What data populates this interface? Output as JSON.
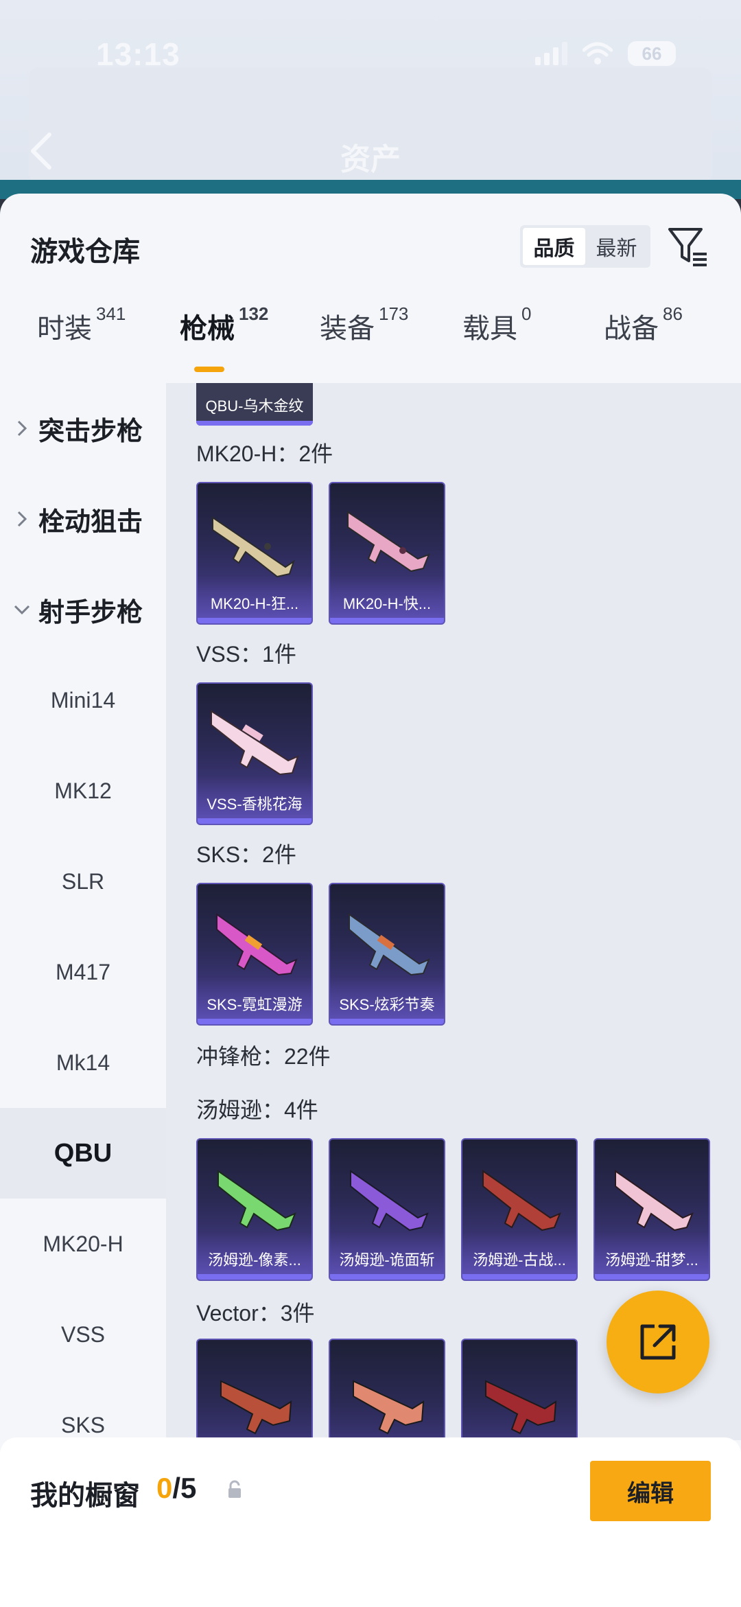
{
  "status_bar": {
    "time": "13:13",
    "battery": "66"
  },
  "header": {
    "title": "资产"
  },
  "warehouse": {
    "title": "游戏仓库",
    "sort_options": [
      "品质",
      "最新"
    ],
    "active_sort": "品质"
  },
  "tabs": [
    {
      "label": "时装",
      "count": "341"
    },
    {
      "label": "枪械",
      "count": "132"
    },
    {
      "label": "装备",
      "count": "173"
    },
    {
      "label": "载具",
      "count": "0"
    },
    {
      "label": "战备",
      "count": "86"
    }
  ],
  "active_tab": "枪械",
  "sidebar": {
    "groups": [
      {
        "label": "突击步枪",
        "expanded": false
      },
      {
        "label": "栓动狙击",
        "expanded": false
      },
      {
        "label": "射手步枪",
        "expanded": true
      }
    ],
    "items": [
      "Mini14",
      "MK12",
      "SLR",
      "M417",
      "Mk14",
      "QBU",
      "MK20-H",
      "VSS",
      "SKS"
    ],
    "active_item": "QBU"
  },
  "content": {
    "partial_item": "QBU-乌木金纹",
    "sections": [
      {
        "label": "MK20-H：2件",
        "items": [
          "MK20-H-狂...",
          "MK20-H-快..."
        ]
      },
      {
        "label": "VSS：1件",
        "items": [
          "VSS-香桃花海"
        ]
      },
      {
        "label": "SKS：2件",
        "items": [
          "SKS-霓虹漫游",
          "SKS-炫彩节奏"
        ]
      },
      {
        "label": "冲锋枪：22件",
        "items": []
      },
      {
        "label": "汤姆逊：4件",
        "items": [
          "汤姆逊-像素...",
          "汤姆逊-诡面斩",
          "汤姆逊-古战...",
          "汤姆逊-甜梦..."
        ]
      },
      {
        "label": "Vector：3件",
        "items": [
          "",
          "",
          ""
        ]
      }
    ]
  },
  "showcase": {
    "title": "我的橱窗",
    "used": "0",
    "total": "/5",
    "edit_label": "编辑"
  },
  "colors": {
    "accent": "#f7a812",
    "card_top": "#1d2036",
    "card_bottom": "#4a3f94",
    "card_border": "#5f55b6"
  },
  "icons": [
    "back-arrow-icon",
    "filter-icon",
    "chevron-right-icon",
    "chevron-down-icon",
    "share-icon",
    "lock-icon"
  ]
}
